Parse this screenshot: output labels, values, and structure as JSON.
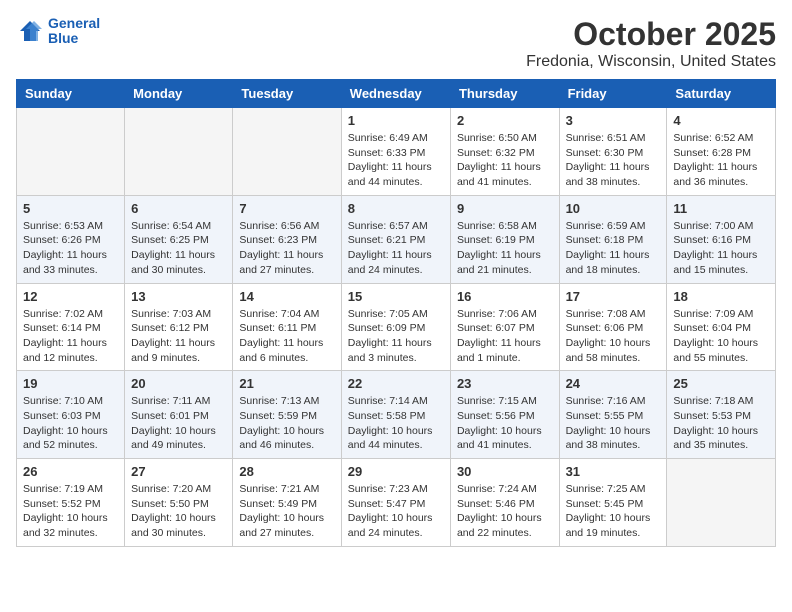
{
  "header": {
    "logo_line1": "General",
    "logo_line2": "Blue",
    "month_title": "October 2025",
    "location": "Fredonia, Wisconsin, United States"
  },
  "weekdays": [
    "Sunday",
    "Monday",
    "Tuesday",
    "Wednesday",
    "Thursday",
    "Friday",
    "Saturday"
  ],
  "weeks": [
    {
      "alt": false,
      "days": [
        {
          "num": "",
          "info": ""
        },
        {
          "num": "",
          "info": ""
        },
        {
          "num": "",
          "info": ""
        },
        {
          "num": "1",
          "info": "Sunrise: 6:49 AM\nSunset: 6:33 PM\nDaylight: 11 hours\nand 44 minutes."
        },
        {
          "num": "2",
          "info": "Sunrise: 6:50 AM\nSunset: 6:32 PM\nDaylight: 11 hours\nand 41 minutes."
        },
        {
          "num": "3",
          "info": "Sunrise: 6:51 AM\nSunset: 6:30 PM\nDaylight: 11 hours\nand 38 minutes."
        },
        {
          "num": "4",
          "info": "Sunrise: 6:52 AM\nSunset: 6:28 PM\nDaylight: 11 hours\nand 36 minutes."
        }
      ]
    },
    {
      "alt": true,
      "days": [
        {
          "num": "5",
          "info": "Sunrise: 6:53 AM\nSunset: 6:26 PM\nDaylight: 11 hours\nand 33 minutes."
        },
        {
          "num": "6",
          "info": "Sunrise: 6:54 AM\nSunset: 6:25 PM\nDaylight: 11 hours\nand 30 minutes."
        },
        {
          "num": "7",
          "info": "Sunrise: 6:56 AM\nSunset: 6:23 PM\nDaylight: 11 hours\nand 27 minutes."
        },
        {
          "num": "8",
          "info": "Sunrise: 6:57 AM\nSunset: 6:21 PM\nDaylight: 11 hours\nand 24 minutes."
        },
        {
          "num": "9",
          "info": "Sunrise: 6:58 AM\nSunset: 6:19 PM\nDaylight: 11 hours\nand 21 minutes."
        },
        {
          "num": "10",
          "info": "Sunrise: 6:59 AM\nSunset: 6:18 PM\nDaylight: 11 hours\nand 18 minutes."
        },
        {
          "num": "11",
          "info": "Sunrise: 7:00 AM\nSunset: 6:16 PM\nDaylight: 11 hours\nand 15 minutes."
        }
      ]
    },
    {
      "alt": false,
      "days": [
        {
          "num": "12",
          "info": "Sunrise: 7:02 AM\nSunset: 6:14 PM\nDaylight: 11 hours\nand 12 minutes."
        },
        {
          "num": "13",
          "info": "Sunrise: 7:03 AM\nSunset: 6:12 PM\nDaylight: 11 hours\nand 9 minutes."
        },
        {
          "num": "14",
          "info": "Sunrise: 7:04 AM\nSunset: 6:11 PM\nDaylight: 11 hours\nand 6 minutes."
        },
        {
          "num": "15",
          "info": "Sunrise: 7:05 AM\nSunset: 6:09 PM\nDaylight: 11 hours\nand 3 minutes."
        },
        {
          "num": "16",
          "info": "Sunrise: 7:06 AM\nSunset: 6:07 PM\nDaylight: 11 hours\nand 1 minute."
        },
        {
          "num": "17",
          "info": "Sunrise: 7:08 AM\nSunset: 6:06 PM\nDaylight: 10 hours\nand 58 minutes."
        },
        {
          "num": "18",
          "info": "Sunrise: 7:09 AM\nSunset: 6:04 PM\nDaylight: 10 hours\nand 55 minutes."
        }
      ]
    },
    {
      "alt": true,
      "days": [
        {
          "num": "19",
          "info": "Sunrise: 7:10 AM\nSunset: 6:03 PM\nDaylight: 10 hours\nand 52 minutes."
        },
        {
          "num": "20",
          "info": "Sunrise: 7:11 AM\nSunset: 6:01 PM\nDaylight: 10 hours\nand 49 minutes."
        },
        {
          "num": "21",
          "info": "Sunrise: 7:13 AM\nSunset: 5:59 PM\nDaylight: 10 hours\nand 46 minutes."
        },
        {
          "num": "22",
          "info": "Sunrise: 7:14 AM\nSunset: 5:58 PM\nDaylight: 10 hours\nand 44 minutes."
        },
        {
          "num": "23",
          "info": "Sunrise: 7:15 AM\nSunset: 5:56 PM\nDaylight: 10 hours\nand 41 minutes."
        },
        {
          "num": "24",
          "info": "Sunrise: 7:16 AM\nSunset: 5:55 PM\nDaylight: 10 hours\nand 38 minutes."
        },
        {
          "num": "25",
          "info": "Sunrise: 7:18 AM\nSunset: 5:53 PM\nDaylight: 10 hours\nand 35 minutes."
        }
      ]
    },
    {
      "alt": false,
      "days": [
        {
          "num": "26",
          "info": "Sunrise: 7:19 AM\nSunset: 5:52 PM\nDaylight: 10 hours\nand 32 minutes."
        },
        {
          "num": "27",
          "info": "Sunrise: 7:20 AM\nSunset: 5:50 PM\nDaylight: 10 hours\nand 30 minutes."
        },
        {
          "num": "28",
          "info": "Sunrise: 7:21 AM\nSunset: 5:49 PM\nDaylight: 10 hours\nand 27 minutes."
        },
        {
          "num": "29",
          "info": "Sunrise: 7:23 AM\nSunset: 5:47 PM\nDaylight: 10 hours\nand 24 minutes."
        },
        {
          "num": "30",
          "info": "Sunrise: 7:24 AM\nSunset: 5:46 PM\nDaylight: 10 hours\nand 22 minutes."
        },
        {
          "num": "31",
          "info": "Sunrise: 7:25 AM\nSunset: 5:45 PM\nDaylight: 10 hours\nand 19 minutes."
        },
        {
          "num": "",
          "info": ""
        }
      ]
    }
  ]
}
